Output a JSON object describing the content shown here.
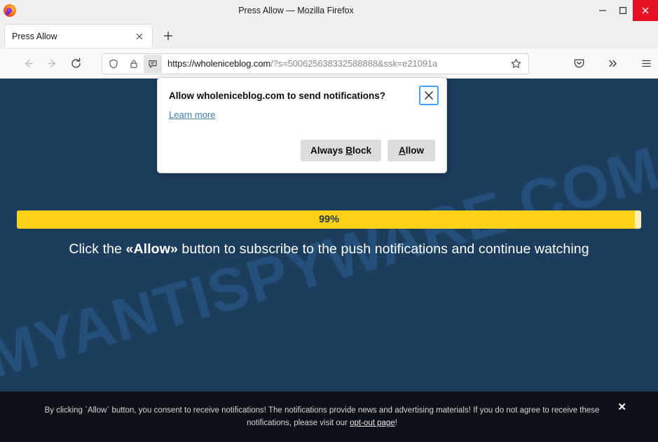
{
  "window": {
    "title": "Press Allow — Mozilla Firefox",
    "minimize_label": "Minimize",
    "maximize_label": "Maximize",
    "close_label": "Close"
  },
  "tabs": {
    "items": [
      {
        "label": "Press Allow",
        "close_label": "Close tab"
      }
    ],
    "new_tab_label": "Open a new tab"
  },
  "toolbar": {
    "back_label": "Go back one page",
    "forward_label": "Go forward one page",
    "reload_label": "Reload current page",
    "pocket_label": "Save to Pocket",
    "overflow_label": "More tools",
    "menu_label": "Open application menu"
  },
  "urlbar": {
    "shield_label": "tracking-protection",
    "lock_label": "connection-not-secure",
    "notification_label": "site-notification-permission",
    "url_domain": "https://wholeniceblog.com",
    "url_query": "/?s=500625638332588888&ssk=e21091a",
    "bookmark_label": "Bookmark this page"
  },
  "permission_popup": {
    "title": "Allow wholeniceblog.com to send notifications?",
    "learn_more": "Learn more",
    "close_label": "Close",
    "block_prefix": "Always ",
    "block_accesskey": "B",
    "block_suffix": "lock",
    "allow_accesskey": "A",
    "allow_suffix": "llow"
  },
  "page": {
    "background_color": "#1d3d5c",
    "watermark": "MYANTISPYWARE.COM",
    "watermark_color": "#2b5f93",
    "progress": {
      "percent": 99,
      "label": "99%",
      "fill_color": "#fdd116",
      "track_color": "#faeeb0"
    },
    "instruction_before": "Click the ",
    "instruction_bold": "«Allow»",
    "instruction_after": " button to subscribe to the push notifications and continue watching"
  },
  "consent_banner": {
    "text_before": "By clicking `Allow` button, you consent to receive notifications! The notifications provide news and advertising materials! If you do not agree to receive these notifications, please visit our ",
    "link": "opt-out page",
    "text_after": "!",
    "close_label": "✕",
    "background_color": "#0d1117"
  }
}
